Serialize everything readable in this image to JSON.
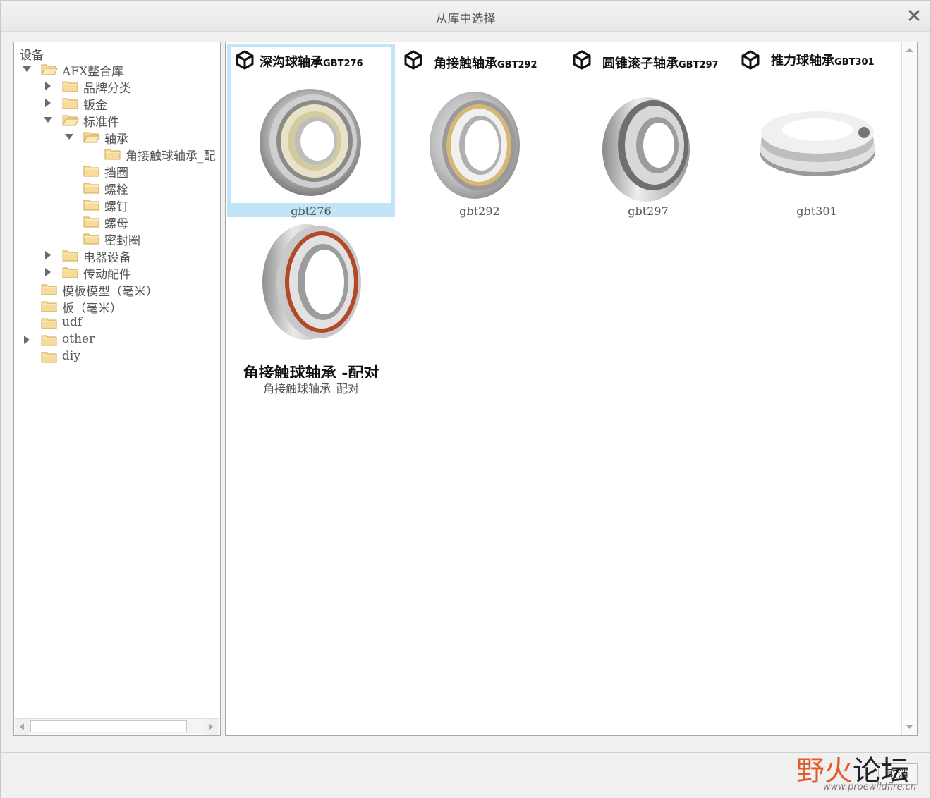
{
  "window": {
    "title": "从库中选择"
  },
  "tree": {
    "header": "设备",
    "nodes": [
      {
        "label": "AFX整合库",
        "level": 0,
        "arrow": "expanded",
        "folder": "open"
      },
      {
        "label": "品牌分类",
        "level": 1,
        "arrow": "collapsed",
        "folder": "closed"
      },
      {
        "label": "钣金",
        "level": 1,
        "arrow": "collapsed",
        "folder": "closed"
      },
      {
        "label": "标准件",
        "level": 1,
        "arrow": "expanded",
        "folder": "open"
      },
      {
        "label": "轴承",
        "level": 2,
        "arrow": "expanded",
        "folder": "open"
      },
      {
        "label": "角接触球轴承_配",
        "level": 3,
        "arrow": "none",
        "folder": "closed"
      },
      {
        "label": "挡圈",
        "level": 2,
        "arrow": "none",
        "folder": "closed"
      },
      {
        "label": "螺栓",
        "level": 2,
        "arrow": "none",
        "folder": "closed"
      },
      {
        "label": "螺钉",
        "level": 2,
        "arrow": "none",
        "folder": "closed"
      },
      {
        "label": "螺母",
        "level": 2,
        "arrow": "none",
        "folder": "closed"
      },
      {
        "label": "密封圈",
        "level": 2,
        "arrow": "none",
        "folder": "closed"
      },
      {
        "label": "电器设备",
        "level": 1,
        "arrow": "collapsed",
        "folder": "closed"
      },
      {
        "label": "传动配件",
        "level": 1,
        "arrow": "collapsed",
        "folder": "closed"
      },
      {
        "label": "模板模型（毫米）",
        "level": 0,
        "arrow": "none",
        "folder": "closed"
      },
      {
        "label": "板（毫米）",
        "level": 0,
        "arrow": "none",
        "folder": "closed"
      },
      {
        "label": "udf",
        "level": 0,
        "arrow": "none",
        "folder": "closed"
      },
      {
        "label": "other",
        "level": 0,
        "arrow": "collapsed",
        "folder": "closed"
      },
      {
        "label": "diy",
        "level": 0,
        "arrow": "none",
        "folder": "closed"
      }
    ]
  },
  "items": [
    {
      "caption": "gbt276",
      "thumb_title": "深沟球轴承",
      "thumb_sub": "GBT276",
      "selected": true,
      "bearing": "deep-groove"
    },
    {
      "caption": "gbt292",
      "thumb_title": "角接触轴承",
      "thumb_sub": "GBT292",
      "selected": false,
      "bearing": "angular"
    },
    {
      "caption": "gbt297",
      "thumb_title": "圆锥滚子轴承",
      "thumb_sub": "GBT297",
      "selected": false,
      "bearing": "tapered"
    },
    {
      "caption": "gbt301",
      "thumb_title": "推力球轴承",
      "thumb_sub": "GBT301",
      "selected": false,
      "bearing": "thrust"
    },
    {
      "caption": "角接触球轴承_配对",
      "thumb_title": "角接触球轴承 -配对",
      "thumb_sub": "",
      "selected": false,
      "bearing": "paired"
    }
  ],
  "footer": {
    "cancel_label": "取消"
  },
  "watermark": {
    "text_red": "野火",
    "text_black": "论坛",
    "url": "www.proewildfire.cn"
  },
  "colors": {
    "selection": "#c2e4f8",
    "folder": "#f6dc98",
    "folder_edge": "#c9a955",
    "wm_red": "#e25b2d"
  }
}
